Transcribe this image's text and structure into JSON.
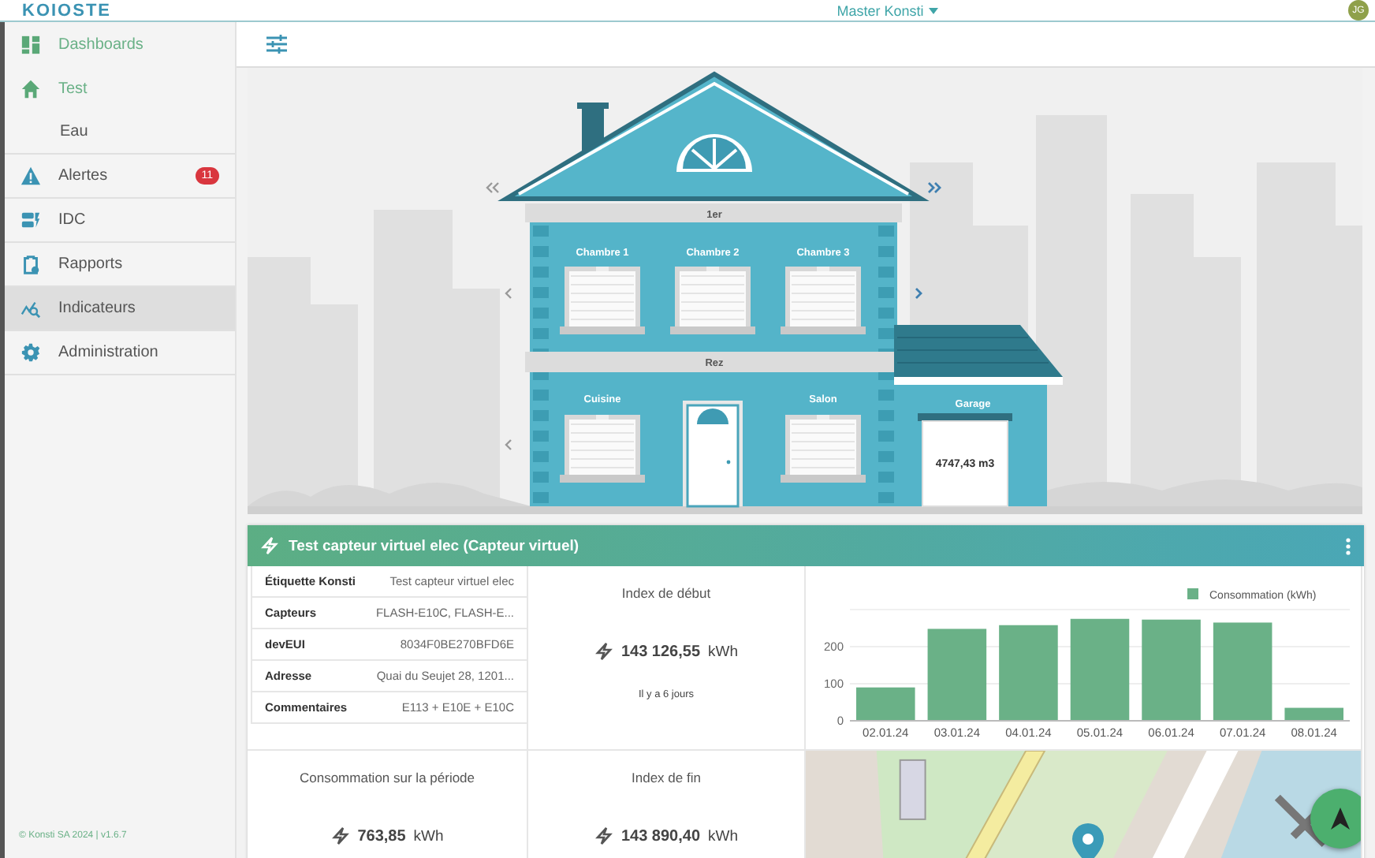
{
  "header": {
    "logo": "KOIOSTE",
    "account": "Master Konsti",
    "avatar": "JG"
  },
  "sidebar": {
    "items": [
      {
        "label": "Dashboards",
        "active": true,
        "selected": false
      },
      {
        "label": "Test",
        "active": true,
        "selected": false,
        "children": [
          {
            "label": "Eau",
            "active": false,
            "selected": false
          }
        ]
      },
      {
        "label": "Alertes",
        "active": false,
        "selected": false,
        "badge": "11"
      },
      {
        "label": "IDC",
        "active": false,
        "selected": false
      },
      {
        "label": "Rapports",
        "active": false,
        "selected": false
      },
      {
        "label": "Indicateurs",
        "active": false,
        "selected": true
      },
      {
        "label": "Administration",
        "active": false,
        "selected": false
      }
    ],
    "footer": "© Konsti SA 2024 | v1.6.7"
  },
  "house": {
    "floors": [
      {
        "name": "1er",
        "rooms": [
          "Chambre 1",
          "Chambre 2",
          "Chambre 3"
        ]
      },
      {
        "name": "Rez",
        "rooms": [
          "Cuisine",
          "Salon"
        ]
      }
    ],
    "garage": {
      "name": "Garage",
      "reading": "4747,43 m3"
    }
  },
  "card": {
    "title": "Test capteur virtuel elec (Capteur virtuel)",
    "details": [
      {
        "label": "Étiquette Konsti",
        "value": "Test capteur virtuel elec"
      },
      {
        "label": "Capteurs",
        "value": "FLASH-E10C, FLASH-E..."
      },
      {
        "label": "devEUI",
        "value": "8034F0BE270BFD6E"
      },
      {
        "label": "Adresse",
        "value": "Quai du Seujet 28, 1201..."
      },
      {
        "label": "Commentaires",
        "value": "E113 + E10E + E10C"
      }
    ],
    "tiles": [
      {
        "title": "Index de début",
        "value": "143 126,55",
        "unit": "kWh",
        "note": "Il y a 6 jours"
      },
      {
        "title": "Consommation sur la période",
        "value": "763,85",
        "unit": "kWh"
      },
      {
        "title": "Index de fin",
        "value": "143 890,40",
        "unit": "kWh"
      }
    ],
    "chart_data": {
      "type": "bar",
      "categories": [
        "02.01.24",
        "03.01.24",
        "04.01.24",
        "05.01.24",
        "06.01.24",
        "07.01.24",
        "08.01.24"
      ],
      "series": [
        {
          "name": "Consommation (kWh)",
          "color": "#6ab187",
          "values": [
            90,
            248,
            258,
            275,
            273,
            265,
            35
          ]
        }
      ],
      "ylim": [
        0,
        300
      ],
      "yticks": [
        0,
        100,
        200
      ]
    }
  }
}
